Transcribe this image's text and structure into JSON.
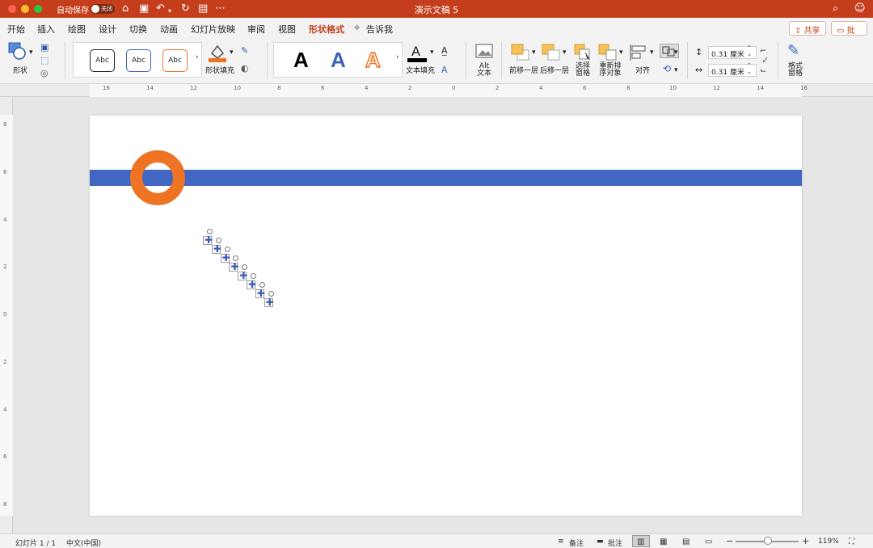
{
  "titlebar": {
    "autosave_label": "自动保存",
    "toggle_label": "关闭",
    "title": "演示文稿 5"
  },
  "tabs": [
    {
      "label": "开始"
    },
    {
      "label": "插入"
    },
    {
      "label": "绘图"
    },
    {
      "label": "设计"
    },
    {
      "label": "切换"
    },
    {
      "label": "动画"
    },
    {
      "label": "幻灯片放映"
    },
    {
      "label": "审阅"
    },
    {
      "label": "视图"
    },
    {
      "label": "形状格式"
    },
    {
      "label": "告诉我"
    }
  ],
  "header_buttons": {
    "share": "共享",
    "comments": "批注"
  },
  "ribbon": {
    "shapes_label": "形状",
    "style_samples": [
      "Abc",
      "Abc",
      "Abc"
    ],
    "shape_fill_label": "形状填充",
    "text_samples": [
      "A",
      "A",
      "A"
    ],
    "text_fill_label": "文本填充",
    "alt_text_label": "Alt\n文本",
    "bring_forward_label": "前移一层",
    "send_backward_label": "后移一层",
    "selection_pane_label": "选择\n窗格",
    "reorder_label": "重新排\n序对象",
    "align_label": "对齐",
    "height_value": "0.31 厘米",
    "width_value": "0.31 厘米",
    "format_pane_label": "格式\n窗格"
  },
  "ruler": {
    "h_labels": [
      "16",
      "14",
      "12",
      "10",
      "8",
      "6",
      "4",
      "2",
      "0",
      "2",
      "4",
      "6",
      "8",
      "10",
      "12",
      "14",
      "16"
    ],
    "v_labels": [
      "8",
      "6",
      "4",
      "2",
      "0",
      "2",
      "4",
      "6",
      "8"
    ]
  },
  "statusbar": {
    "slide_info": "幻灯片 1 / 1",
    "language": "中文(中国)",
    "notes": "备注",
    "comments": "批注",
    "zoom": "119%"
  },
  "colors": {
    "accent": "#c43e1c",
    "bar_blue": "#4167c2",
    "ring_orange": "#ee7322"
  }
}
